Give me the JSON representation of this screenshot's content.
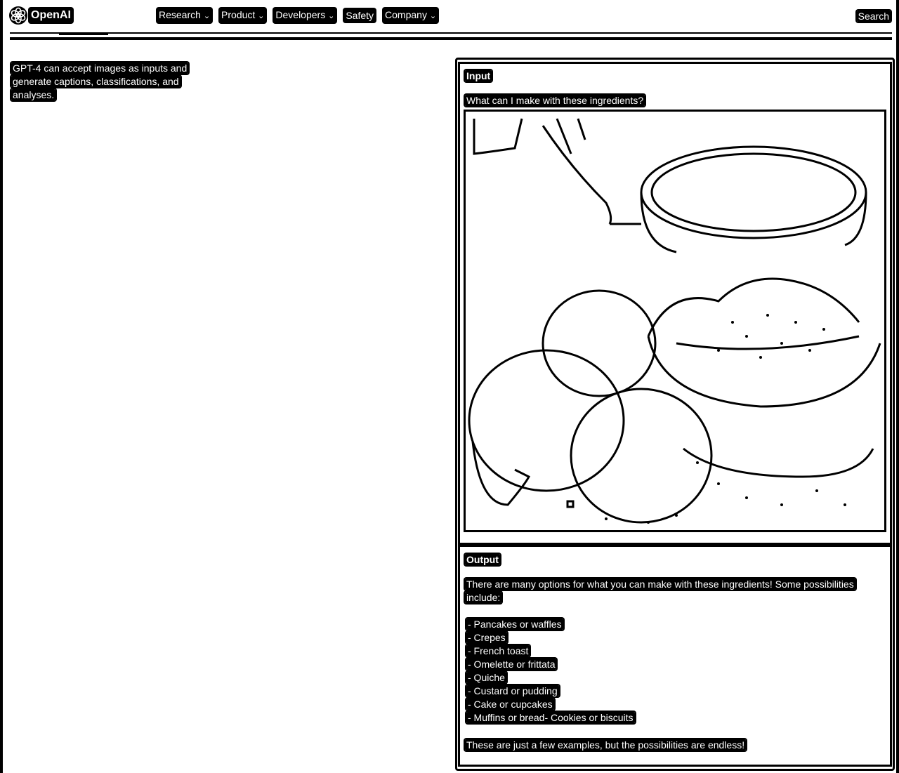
{
  "header": {
    "logo_text": "OpenAI",
    "nav": [
      {
        "label": "Research",
        "has_dropdown": true
      },
      {
        "label": "Product",
        "has_dropdown": true
      },
      {
        "label": "Developers",
        "has_dropdown": true
      },
      {
        "label": "Safety",
        "has_dropdown": false
      },
      {
        "label": "Company",
        "has_dropdown": true
      }
    ],
    "search_label": "Search"
  },
  "caption": {
    "text": "GPT-4 can accept images as inputs and generate captions, classifications, and analyses."
  },
  "input": {
    "label": "Input",
    "prompt": "What can I make with these ingredients?",
    "image_icon": "ingredients-photo"
  },
  "output": {
    "label": "Output",
    "intro": "There are many options for what you can make with these ingredients! Some possibilities include:",
    "items": [
      "- Pancakes or waffles",
      "- Crepes",
      "- French toast",
      "- Omelette or frittata",
      "- Quiche",
      "- Custard or pudding",
      "- Cake or cupcakes",
      "- Muffins or bread- Cookies or biscuits"
    ],
    "closing": "These are just a few examples, but the possibilities are endless!"
  }
}
